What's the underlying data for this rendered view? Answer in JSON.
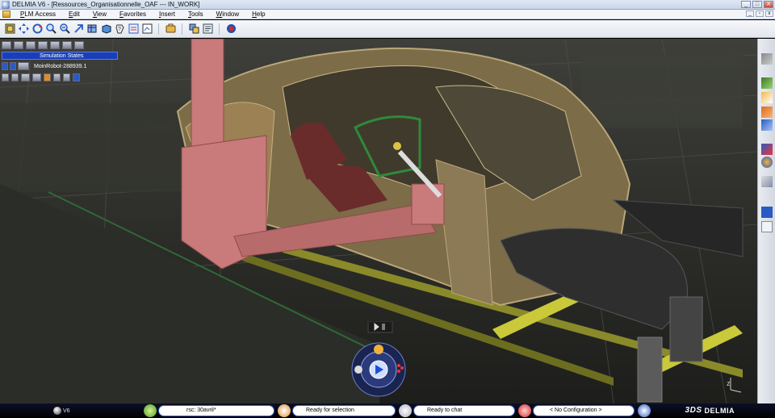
{
  "window": {
    "title": "DELMIA V6 - [Ressources_Organisationnelle_OAF --- IN_WORK]",
    "buttons": [
      "_",
      "□",
      "X"
    ]
  },
  "menu": {
    "items": [
      "PLM Access",
      "Edit",
      "View",
      "Favorites",
      "Insert",
      "Tools",
      "Window",
      "Help"
    ],
    "sub_buttons": [
      "_",
      "▫",
      "x"
    ]
  },
  "toolbar": {
    "icons": [
      "fit-all-icon",
      "pan-icon",
      "rotate-icon",
      "zoom-in-icon",
      "zoom-out-icon",
      "normal-view-icon",
      "iso-view-icon",
      "shading-icon",
      "hide-show-icon",
      "swap-icon",
      "fly-icon",
      "cut-icon",
      "search-icon",
      "bom-icon",
      "catalog-icon"
    ]
  },
  "simulation": {
    "panel_title": "Simulation States",
    "robot_label": "MoinRobot-288939.1"
  },
  "status": {
    "version": "V6",
    "search_value": "rsc: 30avril*",
    "selection_status": "Ready for selection",
    "chat_status": "Ready to chat",
    "configuration": "< No Configuration >",
    "brand": "DELMIA"
  },
  "colors": {
    "accent": "#1a3eb8",
    "conveyor": "#c9c93a",
    "robot_arm": "#c97a7a"
  }
}
